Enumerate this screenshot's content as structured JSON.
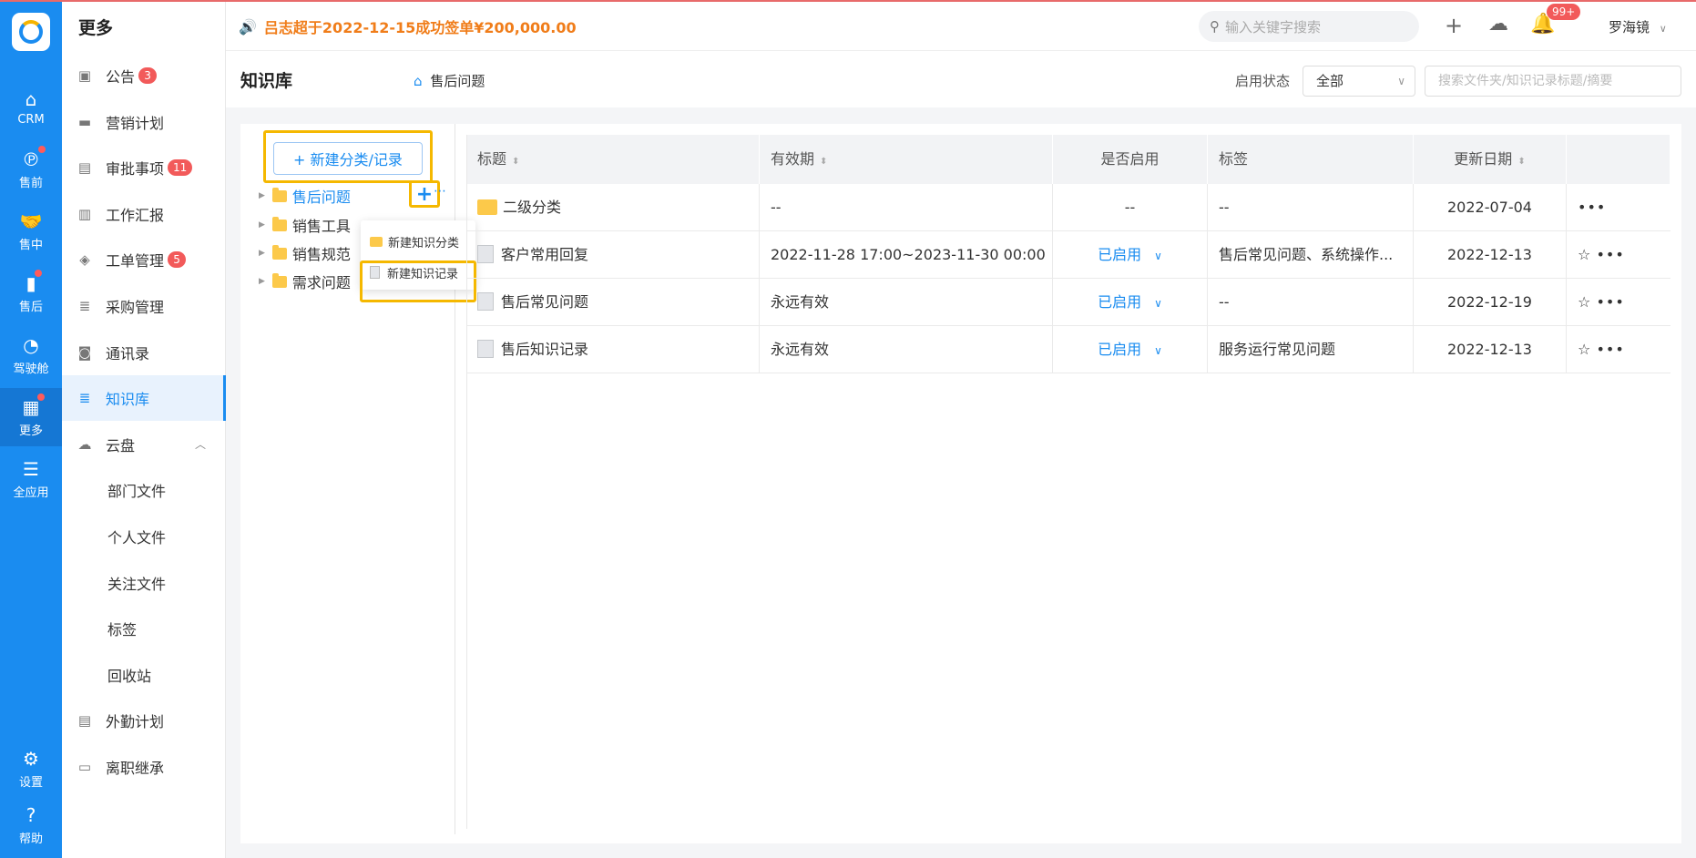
{
  "rail": {
    "items": [
      {
        "label": "CRM",
        "icon": "home-icon",
        "glyph": "⌂",
        "dot": false,
        "active": false
      },
      {
        "label": "售前",
        "icon": "pinterest-icon",
        "glyph": "℗",
        "dot": true,
        "active": false
      },
      {
        "label": "售中",
        "icon": "handshake-icon",
        "glyph": "🤝",
        "dot": false,
        "active": false
      },
      {
        "label": "售后",
        "icon": "service-icon",
        "glyph": "▮",
        "dot": true,
        "active": false
      },
      {
        "label": "驾驶舱",
        "icon": "dashboard-icon",
        "glyph": "◔",
        "dot": false,
        "active": false
      },
      {
        "label": "更多",
        "icon": "grid-icon",
        "glyph": "▦",
        "dot": true,
        "active": true
      },
      {
        "label": "全应用",
        "icon": "menu-icon",
        "glyph": "☰",
        "dot": false,
        "active": false
      }
    ],
    "settings": {
      "label": "设置",
      "glyph": "⚙"
    },
    "help": {
      "label": "帮助",
      "glyph": "?"
    }
  },
  "sidebar": {
    "title": "更多",
    "items": [
      {
        "label": "公告",
        "icon": "announcement-icon",
        "glyph": "▣",
        "badge": "3"
      },
      {
        "label": "营销计划",
        "icon": "briefcase-icon",
        "glyph": "▬",
        "badge": ""
      },
      {
        "label": "审批事项",
        "icon": "calendar-icon",
        "glyph": "▤",
        "badge": "11"
      },
      {
        "label": "工作汇报",
        "icon": "document-icon",
        "glyph": "▥",
        "badge": ""
      },
      {
        "label": "工单管理",
        "icon": "box-icon",
        "glyph": "◈",
        "badge": "5"
      },
      {
        "label": "采购管理",
        "icon": "database-icon",
        "glyph": "≣",
        "badge": ""
      },
      {
        "label": "通讯录",
        "icon": "contacts-icon",
        "glyph": "◙",
        "badge": ""
      },
      {
        "label": "知识库",
        "icon": "knowledge-icon",
        "glyph": "≣",
        "badge": ""
      },
      {
        "label": "云盘",
        "icon": "cloud-icon",
        "glyph": "☁",
        "badge": ""
      }
    ],
    "sub_items": [
      "部门文件",
      "个人文件",
      "关注文件",
      "标签",
      "回收站"
    ],
    "bottom_items": [
      {
        "label": "外勤计划",
        "icon": "calendar-icon",
        "glyph": "▤"
      },
      {
        "label": "离职继承",
        "icon": "id-card-icon",
        "glyph": "▭"
      }
    ]
  },
  "header": {
    "notice": "吕志超于2022-12-15成功签单¥200,000.00",
    "search_placeholder": "输入关键字搜索",
    "bell_badge": "99+",
    "user": "罗海镜"
  },
  "titlebar": {
    "title": "知识库",
    "breadcrumb": "售后问题",
    "status_label": "启用状态",
    "status_value": "全部",
    "search_placeholder": "搜索文件夹/知识记录标题/摘要"
  },
  "tree": {
    "new_button": "+ 新建分类/记录",
    "nodes": [
      "售后问题",
      "销售工具",
      "销售规范",
      "需求问题"
    ],
    "popup": {
      "new_category": "新建知识分类",
      "new_record": "新建知识记录"
    }
  },
  "table": {
    "columns": [
      "标题",
      "有效期",
      "是否启用",
      "标签",
      "更新日期"
    ],
    "rows": [
      {
        "type": "folder",
        "title": "二级分类",
        "validity": "--",
        "enabled": "--",
        "tags": "--",
        "date": "2022-07-04",
        "star": false
      },
      {
        "type": "doc",
        "title": "客户常用回复",
        "validity": "2022-11-28 17:00~2023-11-30 00:00",
        "enabled": "已启用",
        "tags": "售后常见问题、系统操作...",
        "date": "2022-12-13",
        "star": true
      },
      {
        "type": "doc",
        "title": "售后常见问题",
        "validity": "永远有效",
        "enabled": "已启用",
        "tags": "--",
        "date": "2022-12-19",
        "star": true
      },
      {
        "type": "doc",
        "title": "售后知识记录",
        "validity": "永远有效",
        "enabled": "已启用",
        "tags": "服务运行常见问题",
        "date": "2022-12-13",
        "star": true
      }
    ]
  }
}
